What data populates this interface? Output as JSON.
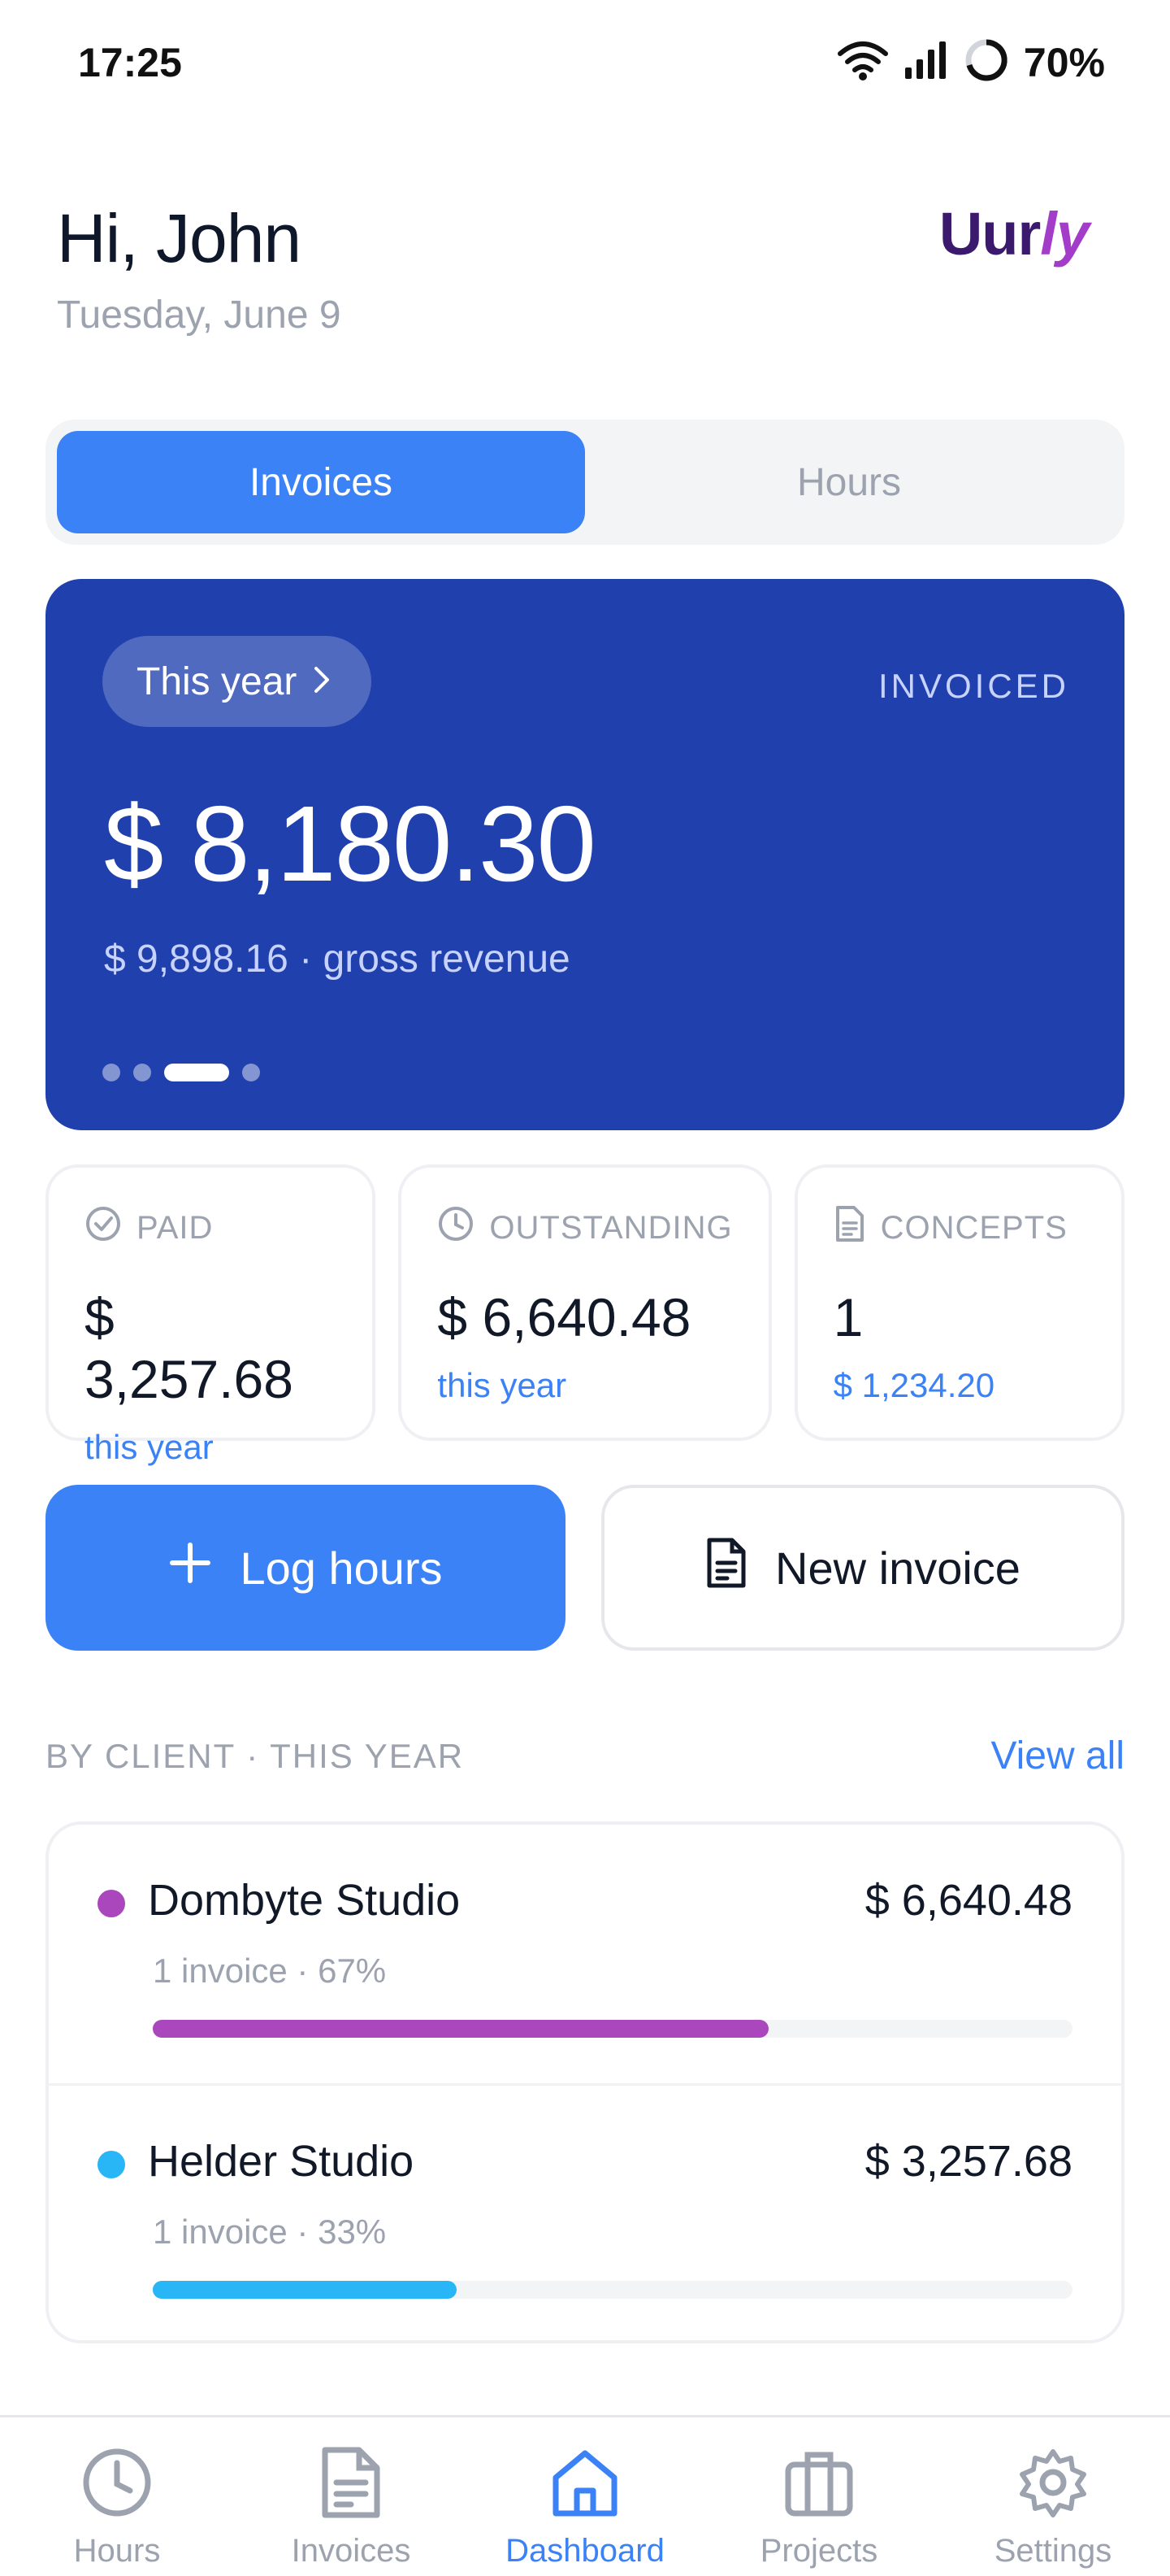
{
  "status_bar": {
    "time": "17:25",
    "battery": "70%",
    "icons": [
      "wifi-icon",
      "signal-icon",
      "battery-ring-icon"
    ]
  },
  "header": {
    "greeting": "Hi, John",
    "date": "Tuesday, June 9",
    "logo_main": "Uur",
    "logo_accent": "ly"
  },
  "segmented": {
    "tabs": [
      {
        "label": "Invoices",
        "active": true
      },
      {
        "label": "Hours",
        "active": false
      }
    ]
  },
  "hero": {
    "period": "This year",
    "label": "INVOICED",
    "amount": "$ 8,180.30",
    "gross": "$ 9,898.16",
    "gross_label": "gross revenue",
    "page_count": 4,
    "active_page": 3
  },
  "stats": [
    {
      "label": "PAID",
      "icon": "check-circle-icon",
      "value": "$ 3,257.68",
      "sub": "this year"
    },
    {
      "label": "OUTSTANDING",
      "icon": "clock-icon",
      "value": "$ 6,640.48",
      "sub": "this year"
    },
    {
      "label": "CONCEPTS",
      "icon": "document-icon",
      "value": "1",
      "sub": "$ 1,234.20"
    }
  ],
  "actions": {
    "log_hours": "Log hours",
    "new_invoice": "New invoice"
  },
  "by_client": {
    "title_left": "BY CLIENT",
    "title_right": "THIS YEAR",
    "view_all": "View all",
    "clients": [
      {
        "name": "Dombyte Studio",
        "amount": "$ 6,640.48",
        "invoices": "1 invoice",
        "percent_label": "67%",
        "share": 0.67,
        "color": "#ab47bc"
      },
      {
        "name": "Helder Studio",
        "amount": "$ 3,257.68",
        "invoices": "1 invoice",
        "percent_label": "33%",
        "share": 0.33,
        "color": "#29b6f6"
      }
    ]
  },
  "tabbar": {
    "tabs": [
      {
        "label": "Hours",
        "icon": "clock-icon",
        "active": false
      },
      {
        "label": "Invoices",
        "icon": "invoice-icon",
        "active": false
      },
      {
        "label": "Dashboard",
        "icon": "home-icon",
        "active": true
      },
      {
        "label": "Projects",
        "icon": "briefcase-icon",
        "active": false
      },
      {
        "label": "Settings",
        "icon": "gear-icon",
        "active": false
      }
    ]
  },
  "colors": {
    "primary": "#3b82f6",
    "hero_bg": "#1f40ad",
    "muted_text": "#9ca3af"
  }
}
